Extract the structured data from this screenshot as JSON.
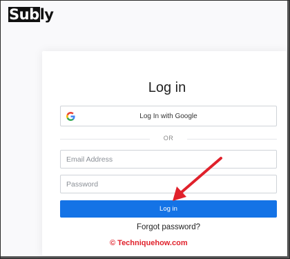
{
  "brand": {
    "logo_box": "Sub",
    "logo_rest": "ly"
  },
  "login_card": {
    "title": "Log in",
    "google_button_label": "Log In with Google",
    "divider_text": "OR",
    "email_placeholder": "Email Address",
    "password_placeholder": "Password",
    "login_button_label": "Log in",
    "forgot_password_link": "Forgot password?"
  },
  "watermark": {
    "text": "© Techniquehow.com"
  },
  "icons": {
    "google": "google-icon",
    "annotation": "red-arrow-icon"
  },
  "colors": {
    "accent": "#1473e6",
    "annotation": "#e0212b",
    "google_blue": "#4285F4",
    "google_red": "#EA4335",
    "google_yellow": "#FBBC05",
    "google_green": "#34A853"
  }
}
